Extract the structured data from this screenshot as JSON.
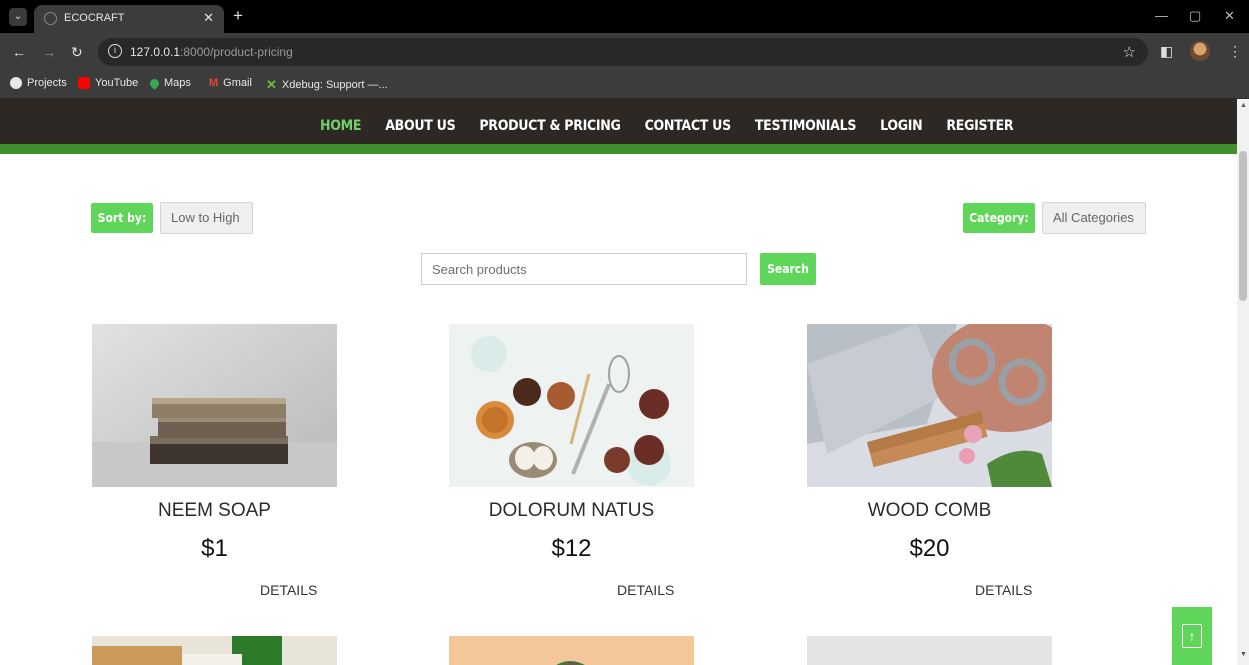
{
  "browser": {
    "tab_title": "ECOCRAFT",
    "url_host": "127.0.0.1",
    "url_rest": ":8000/product-pricing",
    "bookmarks": [
      {
        "label": "Projects",
        "color": "#e8e8e8"
      },
      {
        "label": "YouTube",
        "color": "#ff0000"
      },
      {
        "label": "Maps",
        "color": "#34a853"
      },
      {
        "label": "Gmail",
        "color": "#ea4335"
      },
      {
        "label": "Xdebug: Support —...",
        "color": "#6cbf3a"
      }
    ]
  },
  "nav": {
    "links": [
      "HOME",
      "ABOUT US",
      "PRODUCT & PRICING",
      "CONTACT US",
      "TESTIMONIALS",
      "LOGIN",
      "REGISTER"
    ],
    "active": "HOME"
  },
  "filters": {
    "sort_label": "Sort by:",
    "sort_value": "Low to High",
    "category_label": "Category:",
    "category_value": "All Categories"
  },
  "search": {
    "placeholder": "Search products",
    "button": "Search"
  },
  "products": [
    {
      "name": "NEEM SOAP",
      "price": "$1",
      "details": "DETAILS"
    },
    {
      "name": "DOLORUM NATUS",
      "price": "$12",
      "details": "DETAILS"
    },
    {
      "name": "WOOD COMB",
      "price": "$20",
      "details": "DETAILS"
    }
  ],
  "colors": {
    "accent_green": "#5fd65a",
    "nav_bg": "#2d2824",
    "nav_stripe": "#3f8f2a",
    "active_link": "#6fd06a"
  },
  "back_to_top": "↑"
}
